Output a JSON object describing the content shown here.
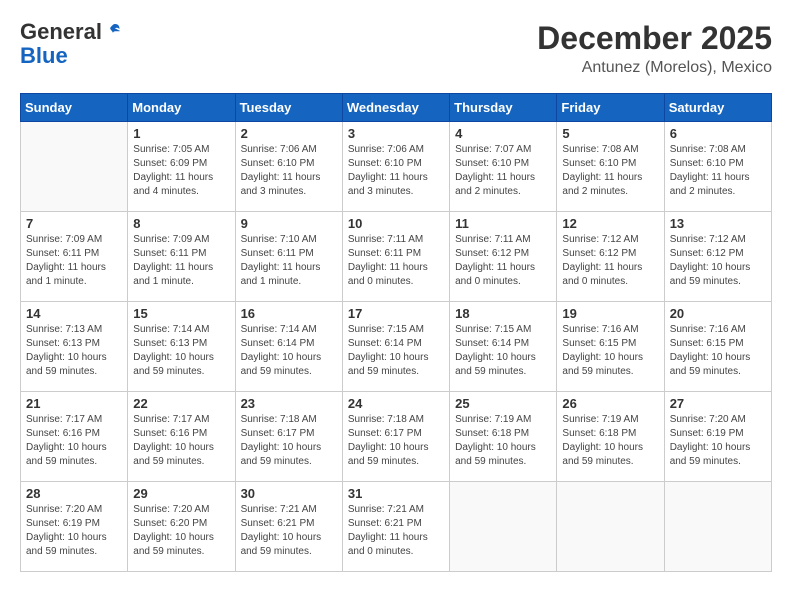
{
  "logo": {
    "general": "General",
    "blue": "Blue"
  },
  "title": "December 2025",
  "location": "Antunez (Morelos), Mexico",
  "headers": [
    "Sunday",
    "Monday",
    "Tuesday",
    "Wednesday",
    "Thursday",
    "Friday",
    "Saturday"
  ],
  "weeks": [
    [
      {
        "day": "",
        "info": ""
      },
      {
        "day": "1",
        "info": "Sunrise: 7:05 AM\nSunset: 6:09 PM\nDaylight: 11 hours\nand 4 minutes."
      },
      {
        "day": "2",
        "info": "Sunrise: 7:06 AM\nSunset: 6:10 PM\nDaylight: 11 hours\nand 3 minutes."
      },
      {
        "day": "3",
        "info": "Sunrise: 7:06 AM\nSunset: 6:10 PM\nDaylight: 11 hours\nand 3 minutes."
      },
      {
        "day": "4",
        "info": "Sunrise: 7:07 AM\nSunset: 6:10 PM\nDaylight: 11 hours\nand 2 minutes."
      },
      {
        "day": "5",
        "info": "Sunrise: 7:08 AM\nSunset: 6:10 PM\nDaylight: 11 hours\nand 2 minutes."
      },
      {
        "day": "6",
        "info": "Sunrise: 7:08 AM\nSunset: 6:10 PM\nDaylight: 11 hours\nand 2 minutes."
      }
    ],
    [
      {
        "day": "7",
        "info": "Sunrise: 7:09 AM\nSunset: 6:11 PM\nDaylight: 11 hours\nand 1 minute."
      },
      {
        "day": "8",
        "info": "Sunrise: 7:09 AM\nSunset: 6:11 PM\nDaylight: 11 hours\nand 1 minute."
      },
      {
        "day": "9",
        "info": "Sunrise: 7:10 AM\nSunset: 6:11 PM\nDaylight: 11 hours\nand 1 minute."
      },
      {
        "day": "10",
        "info": "Sunrise: 7:11 AM\nSunset: 6:11 PM\nDaylight: 11 hours\nand 0 minutes."
      },
      {
        "day": "11",
        "info": "Sunrise: 7:11 AM\nSunset: 6:12 PM\nDaylight: 11 hours\nand 0 minutes."
      },
      {
        "day": "12",
        "info": "Sunrise: 7:12 AM\nSunset: 6:12 PM\nDaylight: 11 hours\nand 0 minutes."
      },
      {
        "day": "13",
        "info": "Sunrise: 7:12 AM\nSunset: 6:12 PM\nDaylight: 10 hours\nand 59 minutes."
      }
    ],
    [
      {
        "day": "14",
        "info": "Sunrise: 7:13 AM\nSunset: 6:13 PM\nDaylight: 10 hours\nand 59 minutes."
      },
      {
        "day": "15",
        "info": "Sunrise: 7:14 AM\nSunset: 6:13 PM\nDaylight: 10 hours\nand 59 minutes."
      },
      {
        "day": "16",
        "info": "Sunrise: 7:14 AM\nSunset: 6:14 PM\nDaylight: 10 hours\nand 59 minutes."
      },
      {
        "day": "17",
        "info": "Sunrise: 7:15 AM\nSunset: 6:14 PM\nDaylight: 10 hours\nand 59 minutes."
      },
      {
        "day": "18",
        "info": "Sunrise: 7:15 AM\nSunset: 6:14 PM\nDaylight: 10 hours\nand 59 minutes."
      },
      {
        "day": "19",
        "info": "Sunrise: 7:16 AM\nSunset: 6:15 PM\nDaylight: 10 hours\nand 59 minutes."
      },
      {
        "day": "20",
        "info": "Sunrise: 7:16 AM\nSunset: 6:15 PM\nDaylight: 10 hours\nand 59 minutes."
      }
    ],
    [
      {
        "day": "21",
        "info": "Sunrise: 7:17 AM\nSunset: 6:16 PM\nDaylight: 10 hours\nand 59 minutes."
      },
      {
        "day": "22",
        "info": "Sunrise: 7:17 AM\nSunset: 6:16 PM\nDaylight: 10 hours\nand 59 minutes."
      },
      {
        "day": "23",
        "info": "Sunrise: 7:18 AM\nSunset: 6:17 PM\nDaylight: 10 hours\nand 59 minutes."
      },
      {
        "day": "24",
        "info": "Sunrise: 7:18 AM\nSunset: 6:17 PM\nDaylight: 10 hours\nand 59 minutes."
      },
      {
        "day": "25",
        "info": "Sunrise: 7:19 AM\nSunset: 6:18 PM\nDaylight: 10 hours\nand 59 minutes."
      },
      {
        "day": "26",
        "info": "Sunrise: 7:19 AM\nSunset: 6:18 PM\nDaylight: 10 hours\nand 59 minutes."
      },
      {
        "day": "27",
        "info": "Sunrise: 7:20 AM\nSunset: 6:19 PM\nDaylight: 10 hours\nand 59 minutes."
      }
    ],
    [
      {
        "day": "28",
        "info": "Sunrise: 7:20 AM\nSunset: 6:19 PM\nDaylight: 10 hours\nand 59 minutes."
      },
      {
        "day": "29",
        "info": "Sunrise: 7:20 AM\nSunset: 6:20 PM\nDaylight: 10 hours\nand 59 minutes."
      },
      {
        "day": "30",
        "info": "Sunrise: 7:21 AM\nSunset: 6:21 PM\nDaylight: 10 hours\nand 59 minutes."
      },
      {
        "day": "31",
        "info": "Sunrise: 7:21 AM\nSunset: 6:21 PM\nDaylight: 11 hours\nand 0 minutes."
      },
      {
        "day": "",
        "info": ""
      },
      {
        "day": "",
        "info": ""
      },
      {
        "day": "",
        "info": ""
      }
    ]
  ]
}
